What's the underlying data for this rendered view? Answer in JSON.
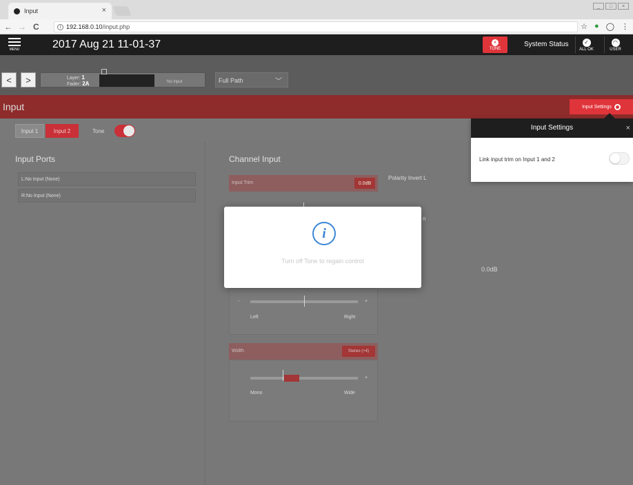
{
  "browser": {
    "tab_title": "Input",
    "tab_close": "×",
    "url_host": "192.168.0.10",
    "url_path": "/input.php",
    "back": "←",
    "forward": "→",
    "reload": "C",
    "star": "☆",
    "menu_dots": "⋮"
  },
  "header": {
    "menu_label": "MENU",
    "datetime": "2017 Aug 21 11-01-37",
    "tone_label": "TONE",
    "system_status": "System Status",
    "all_ok_label": "ALL OK",
    "user_label": "USER"
  },
  "path_bar": {
    "prev": "<",
    "next": ">",
    "layer_label": "Layer:",
    "layer_value": "1",
    "fader_label": "Fader:",
    "fader_value": "2A",
    "no_input": "No input",
    "path_select": "Full Path"
  },
  "title_bar": {
    "title": "Input",
    "settings_button": "Input Settings"
  },
  "input_tabs": {
    "input1": "Input 1",
    "input2": "Input 2",
    "tone_label": "Tone",
    "tone_on": true
  },
  "ports": {
    "heading": "Input Ports",
    "items": [
      "L:No Input (None)",
      "R:No Input (None)"
    ]
  },
  "channel": {
    "heading": "Channel Input",
    "trim_label": "Input Trim",
    "trim_value": "0.0dB",
    "polarity_label": "Polarity Invert L",
    "pan_minus": "-",
    "pan_plus": "+",
    "pan_left": "Left",
    "pan_right": "Right",
    "pan_position": 0.5,
    "width_label": "Width",
    "width_value": "Stereo (+4)",
    "width_minus": "-",
    "width_plus": "+",
    "width_mono": "Mono",
    "width_wide": "Wide",
    "width_position": 0.3,
    "partial_text": "n",
    "right_text": "0.0dB"
  },
  "modal": {
    "icon": "i",
    "message": "Turn off Tone to regain control"
  },
  "settings_panel": {
    "title": "Input Settings",
    "close": "×",
    "link_label": "Link input trim on Input 1 and 2",
    "link_on": false
  },
  "colors": {
    "accent_red": "#e0343b",
    "header_dark": "#1e1e1e",
    "info_blue": "#3a86d4"
  }
}
